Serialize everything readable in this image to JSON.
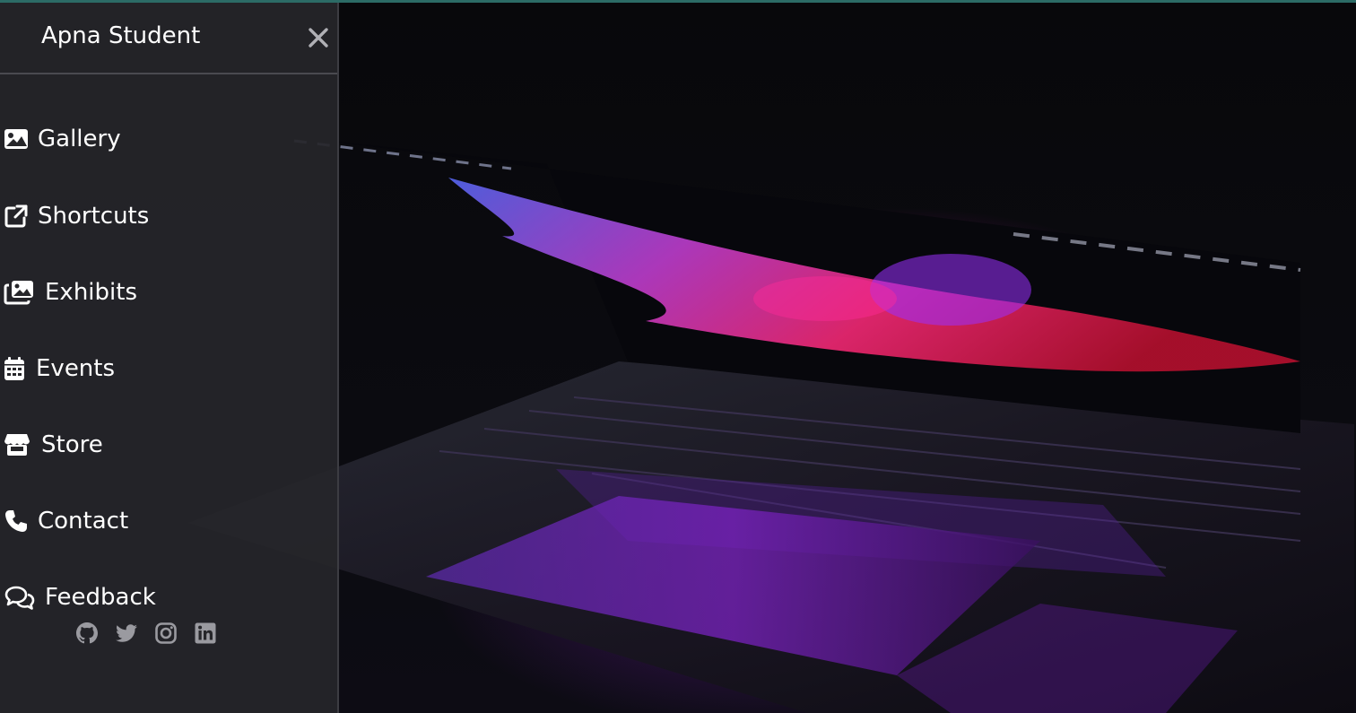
{
  "sidebar": {
    "brand": "Apna Student",
    "close_icon": "close-icon",
    "items": [
      {
        "label": "Gallery",
        "icon": "image-icon"
      },
      {
        "label": "Shortcuts",
        "icon": "external-link-icon"
      },
      {
        "label": "Exhibits",
        "icon": "images-icon"
      },
      {
        "label": "Events",
        "icon": "calendar-icon"
      },
      {
        "label": "Store",
        "icon": "store-icon"
      },
      {
        "label": "Contact",
        "icon": "phone-icon"
      },
      {
        "label": "Feedback",
        "icon": "comments-icon"
      }
    ],
    "socials": [
      "github-icon",
      "twitter-icon",
      "instagram-icon",
      "linkedin-icon"
    ]
  },
  "colors": {
    "sidebar_bg": "#26262a",
    "text": "#ffffff",
    "social_icon": "#9a9aa0",
    "top_accent": "#2c6b66"
  }
}
